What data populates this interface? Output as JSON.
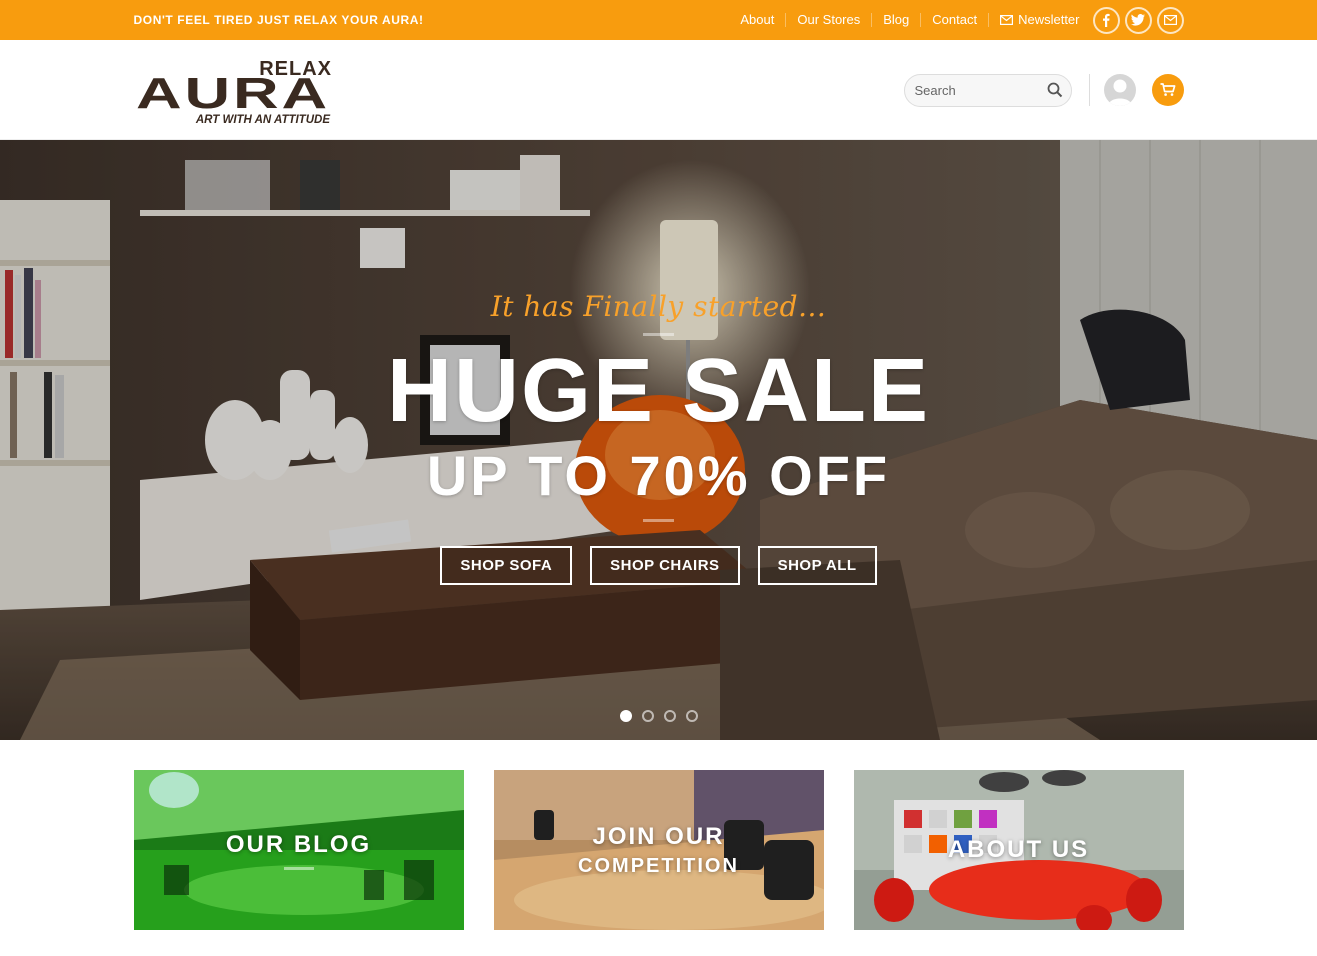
{
  "topbar": {
    "tagline": "DON'T FEEL TIRED JUST RELAX YOUR AURA!",
    "nav": [
      "About",
      "Our Stores",
      "Blog",
      "Contact"
    ],
    "newsletter": "Newsletter",
    "social_icons": [
      "facebook-icon",
      "twitter-icon",
      "email-icon"
    ],
    "bg_color": "#f89c0e"
  },
  "header": {
    "logo_top": "RELAX",
    "logo_main": "AURA",
    "logo_tagline": "ART WITH AN ATTITUDE",
    "search_placeholder": "Search"
  },
  "hero": {
    "script_text": "It has Finally started...",
    "headline": "HUGE SALE",
    "subheadline": "UP TO 70% OFF",
    "buttons": [
      "SHOP SOFA",
      "SHOP CHAIRS",
      "SHOP ALL"
    ],
    "slide_count": 4,
    "active_slide": 1
  },
  "banners": [
    {
      "title": "OUR BLOG",
      "subtitle": ""
    },
    {
      "title": "JOIN OUR",
      "subtitle": "COMPETITION"
    },
    {
      "title": "ABOUT US",
      "subtitle": ""
    }
  ]
}
